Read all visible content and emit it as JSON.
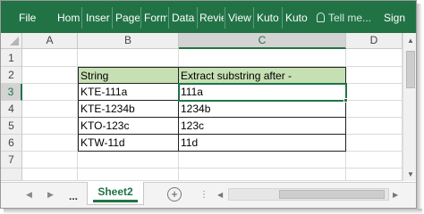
{
  "ribbon": {
    "tabs": [
      "File",
      "Hom",
      "Inser",
      "Page",
      "Form",
      "Data",
      "Revie",
      "View",
      "Kuto",
      "Kuto"
    ],
    "tell_me": "Tell me...",
    "sign_in": "Sign"
  },
  "grid": {
    "columns": [
      "A",
      "B",
      "C",
      "D"
    ],
    "rows": [
      "1",
      "2",
      "3",
      "4",
      "5",
      "6",
      "7"
    ],
    "selected_column": "C",
    "selected_row": "3",
    "header": [
      "String",
      "Extract substring after -"
    ],
    "data": [
      [
        "KTE-111a",
        "111a"
      ],
      [
        "KTE-1234b",
        "1234b"
      ],
      [
        "KTO-123c",
        "123c"
      ],
      [
        "KTW-11d",
        "11d"
      ]
    ]
  },
  "sheets": {
    "ellipsis": "...",
    "active": "Sheet2",
    "add_symbol": "+"
  },
  "colors": {
    "ribbon": "#217346",
    "header_fill": "#c6e0b4"
  }
}
